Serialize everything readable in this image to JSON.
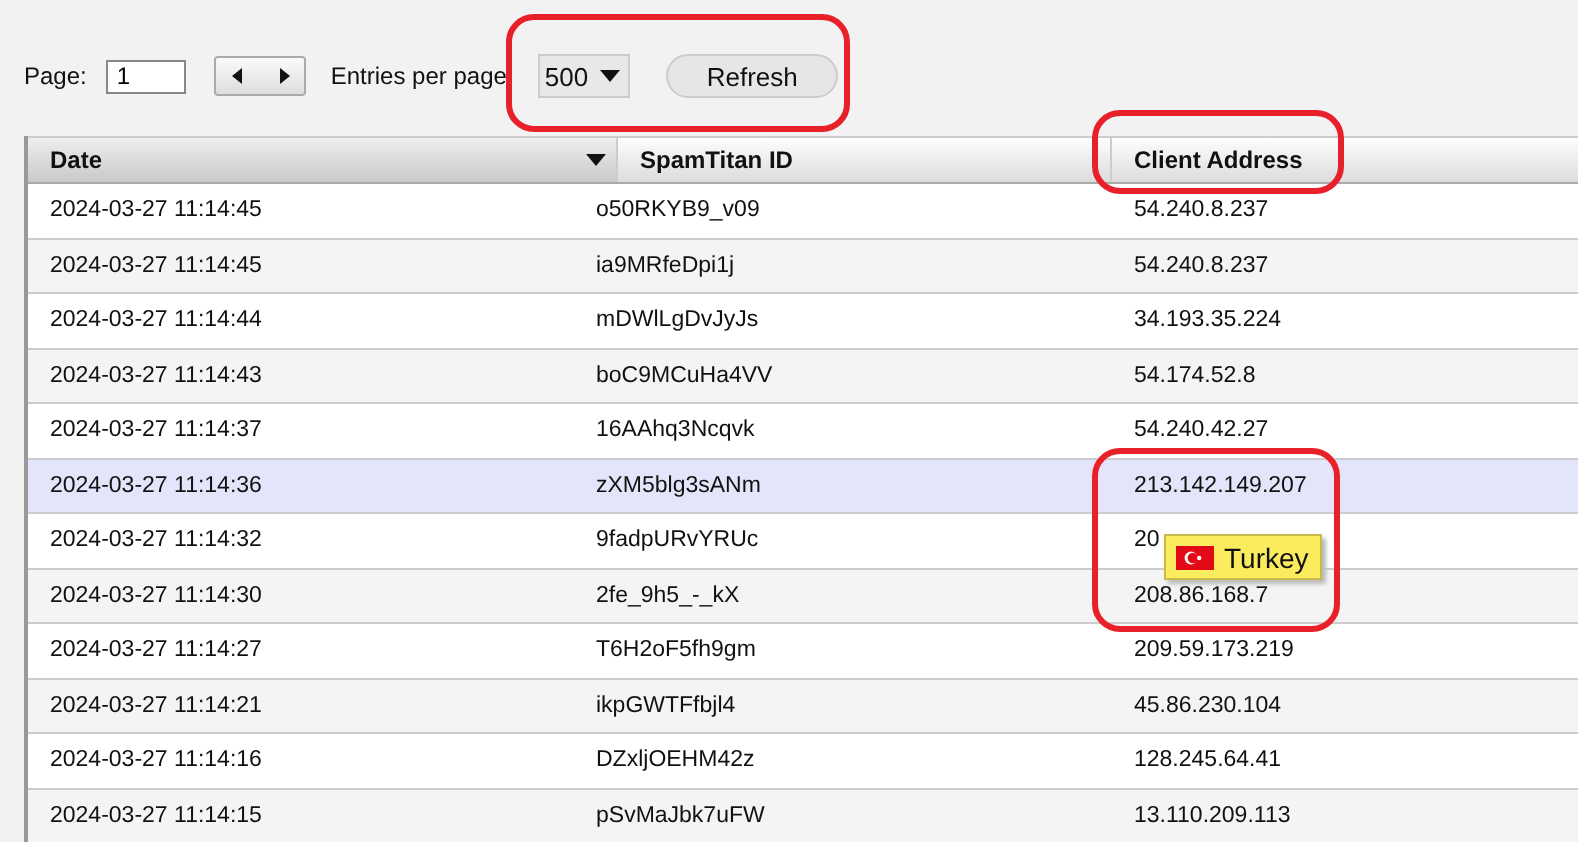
{
  "pager": {
    "page_label": "Page:",
    "page_value": "1",
    "entries_label": "Entries per page",
    "entries_value": "500",
    "refresh_label": "Refresh",
    "circled": true
  },
  "table": {
    "columns": [
      {
        "label": "Date",
        "sorted": true,
        "circled": false
      },
      {
        "label": "SpamTitan ID",
        "sorted": false,
        "circled": false
      },
      {
        "label": "Client Address",
        "sorted": false,
        "circled": true
      }
    ],
    "rows": [
      {
        "cells": [
          "2024-03-27 11:14:45",
          "o50RKYB9_v09",
          "54.240.8.237"
        ],
        "selected": false,
        "circled": false
      },
      {
        "cells": [
          "2024-03-27 11:14:45",
          "ia9MRfeDpi1j",
          "54.240.8.237"
        ],
        "selected": false,
        "circled": false
      },
      {
        "cells": [
          "2024-03-27 11:14:44",
          "mDWlLgDvJyJs",
          "34.193.35.224"
        ],
        "selected": false,
        "circled": false
      },
      {
        "cells": [
          "2024-03-27 11:14:43",
          "boC9MCuHa4VV",
          "54.174.52.8"
        ],
        "selected": false,
        "circled": false
      },
      {
        "cells": [
          "2024-03-27 11:14:37",
          "16AAhq3Ncqvk",
          "54.240.42.27"
        ],
        "selected": false,
        "circled": false
      },
      {
        "cells": [
          "2024-03-27 11:14:36",
          "zXM5blg3sANm",
          "213.142.149.207"
        ],
        "selected": true,
        "circled": true
      },
      {
        "cells": [
          "2024-03-27 11:14:32",
          "9fadpURvYRUc",
          "20"
        ],
        "selected": false,
        "circled": true
      },
      {
        "cells": [
          "2024-03-27 11:14:30",
          "2fe_9h5_-_kX",
          "208.86.168.7"
        ],
        "selected": false,
        "circled": true
      },
      {
        "cells": [
          "2024-03-27 11:14:27",
          "T6H2oF5fh9gm",
          "209.59.173.219"
        ],
        "selected": false,
        "circled": false
      },
      {
        "cells": [
          "2024-03-27 11:14:21",
          "ikpGWTFfbjl4",
          "45.86.230.104"
        ],
        "selected": false,
        "circled": false
      },
      {
        "cells": [
          "2024-03-27 11:14:16",
          "DZxljOEHM42z",
          "128.245.64.41"
        ],
        "selected": false,
        "circled": false
      },
      {
        "cells": [
          "2024-03-27 11:14:15",
          "pSvMaJbk7uFW",
          "13.110.209.113"
        ],
        "selected": false,
        "circled": false
      }
    ]
  },
  "tooltip": {
    "text": "Turkey"
  }
}
